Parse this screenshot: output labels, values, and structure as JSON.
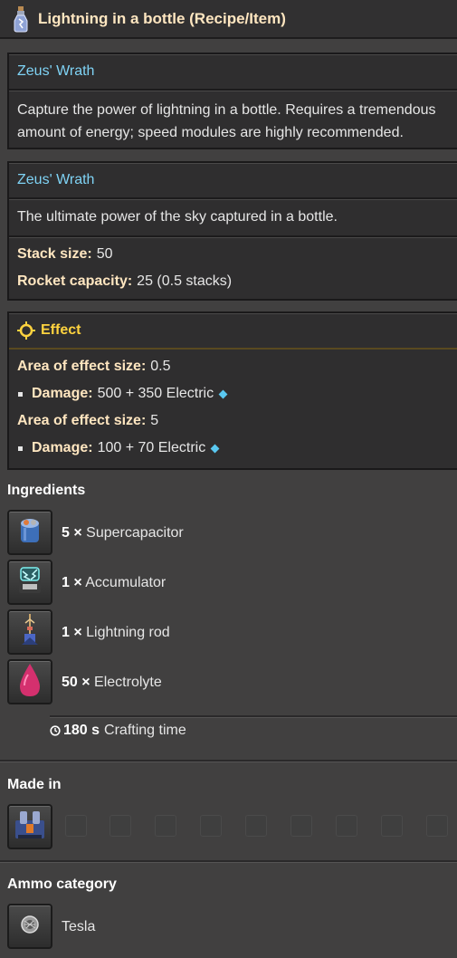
{
  "title": "Lightning in a bottle (Recipe/Item)",
  "recipe_panel": {
    "heading": "Zeus' Wrath",
    "description": "Capture the power of lightning in a bottle. Requires a tremendous amount of energy; speed modules are highly recommended."
  },
  "item_panel": {
    "heading": "Zeus' Wrath",
    "description": "The ultimate power of the sky captured in a bottle.",
    "stack_label": "Stack size:",
    "stack_value": "50",
    "rocket_label": "Rocket capacity:",
    "rocket_value": "25 (0.5 stacks)"
  },
  "effect_panel": {
    "heading": "Effect",
    "effects": [
      {
        "area_label": "Area of effect size:",
        "area_value": "0.5",
        "damage_label": "Damage:",
        "damage_value": "500 + 350 Electric"
      },
      {
        "area_label": "Area of effect size:",
        "area_value": "5",
        "damage_label": "Damage:",
        "damage_value": "100 + 70 Electric"
      }
    ]
  },
  "ingredients": {
    "heading": "Ingredients",
    "items": [
      {
        "amount": "5 ×",
        "name": "Supercapacitor",
        "icon": "supercapacitor-icon"
      },
      {
        "amount": "1 ×",
        "name": "Accumulator",
        "icon": "accumulator-icon"
      },
      {
        "amount": "1 ×",
        "name": "Lightning rod",
        "icon": "lightning-rod-icon"
      },
      {
        "amount": "50 ×",
        "name": "Electrolyte",
        "icon": "electrolyte-icon"
      }
    ],
    "crafting_time_value": "180 s",
    "crafting_time_label": "Crafting time"
  },
  "made_in": {
    "heading": "Made in",
    "machine_icon": "electromagnetic-plant-icon"
  },
  "ammo": {
    "heading": "Ammo category",
    "name": "Tesla",
    "icon": "tesla-ammo-icon"
  },
  "colors": {
    "background": "#414040",
    "panel": "#2f2e2f",
    "heading_blue": "#7fd3f5",
    "label_cream": "#ffe6c0",
    "effect_yellow": "#ffd33f",
    "electric_diamond": "#5ac8f0"
  }
}
